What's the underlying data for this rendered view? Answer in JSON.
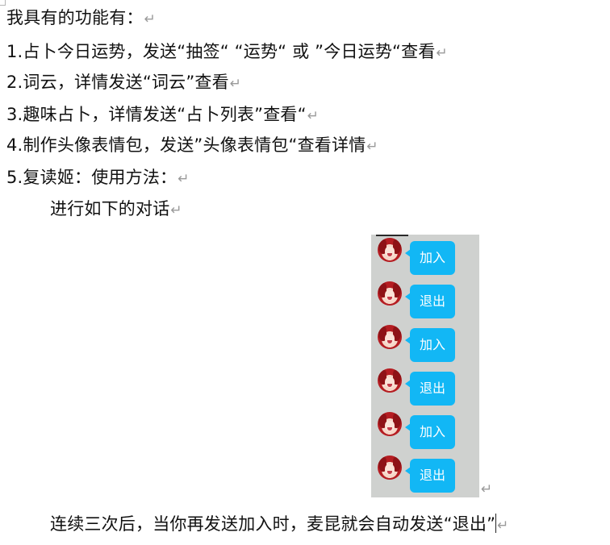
{
  "document": {
    "paragraph_mark": "↵",
    "lines": [
      "我具有的功能有：",
      "1.占卜今日运势，发送“抽签“ “运势“ 或 ”今日运势“查看",
      "2.词云，详情发送“词云”查看",
      "3.趣味占卜，详情发送“占卜列表”查看“",
      "4.制作头像表情包，发送”头像表情包“查看详情",
      "5.复读姬：使用方法：",
      "进行如下的对话"
    ],
    "chat_messages": [
      {
        "sender": "avatar",
        "text": "加入"
      },
      {
        "sender": "avatar",
        "text": "退出"
      },
      {
        "sender": "avatar",
        "text": "加入"
      },
      {
        "sender": "avatar",
        "text": "退出"
      },
      {
        "sender": "avatar",
        "text": "加入"
      },
      {
        "sender": "avatar",
        "text": "退出"
      }
    ],
    "closing_line": "连续三次后，当你再发送加入时，麦昆就会自动发送“退出”"
  },
  "colors": {
    "bubble": "#12b7f5",
    "chat_background": "#cfd1cf",
    "paragraph_mark": "#9a9a9a"
  }
}
